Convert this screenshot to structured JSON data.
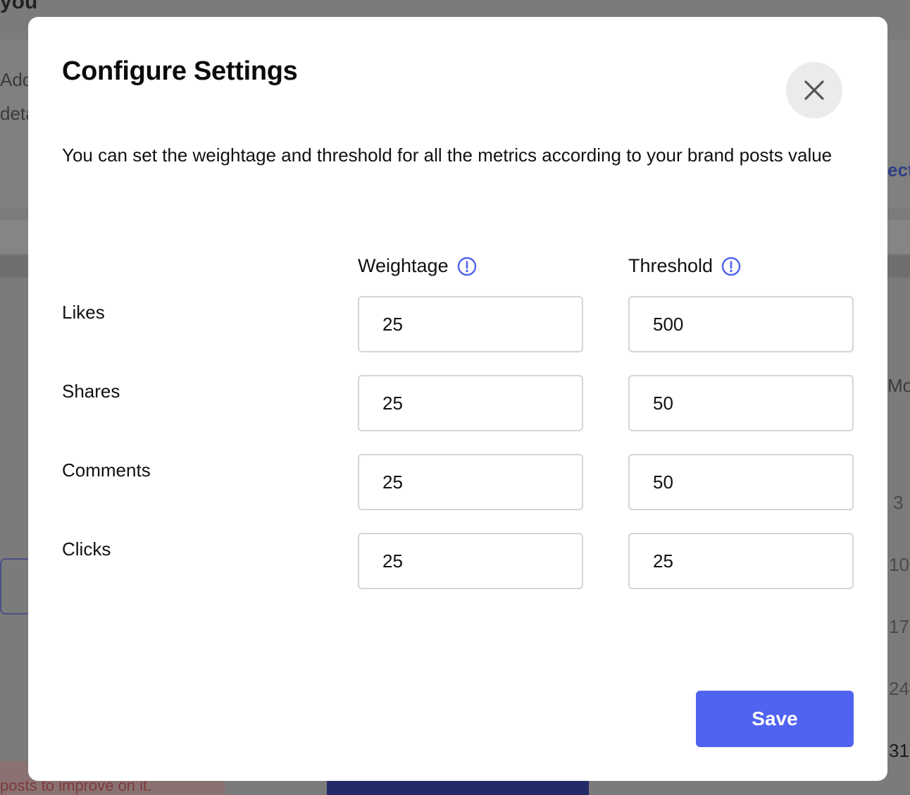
{
  "background": {
    "heading_fragment": "you",
    "left_text_1": "Add",
    "left_text_2": "deta",
    "right_link": "ect",
    "right_text": "Mo",
    "calendar_numbers": [
      "3",
      "10",
      "17",
      "24",
      "31"
    ],
    "bottom_text": "posts to improve on it."
  },
  "modal": {
    "title": "Configure Settings",
    "description": "You can set the weightage and threshold for all the metrics according to your brand posts value",
    "columns": {
      "weightage": "Weightage",
      "threshold": "Threshold"
    },
    "metrics": [
      {
        "label": "Likes",
        "weightage": "25",
        "threshold": "500"
      },
      {
        "label": "Shares",
        "weightage": "25",
        "threshold": "50"
      },
      {
        "label": "Comments",
        "weightage": "25",
        "threshold": "50"
      },
      {
        "label": "Clicks",
        "weightage": "25",
        "threshold": "25"
      }
    ],
    "save_label": "Save"
  },
  "colors": {
    "accent": "#4f62f0",
    "overlay": "#7a7a7a",
    "close_bg": "#ebebeb"
  },
  "icons": {
    "close": "close-icon",
    "info": "info-icon"
  }
}
